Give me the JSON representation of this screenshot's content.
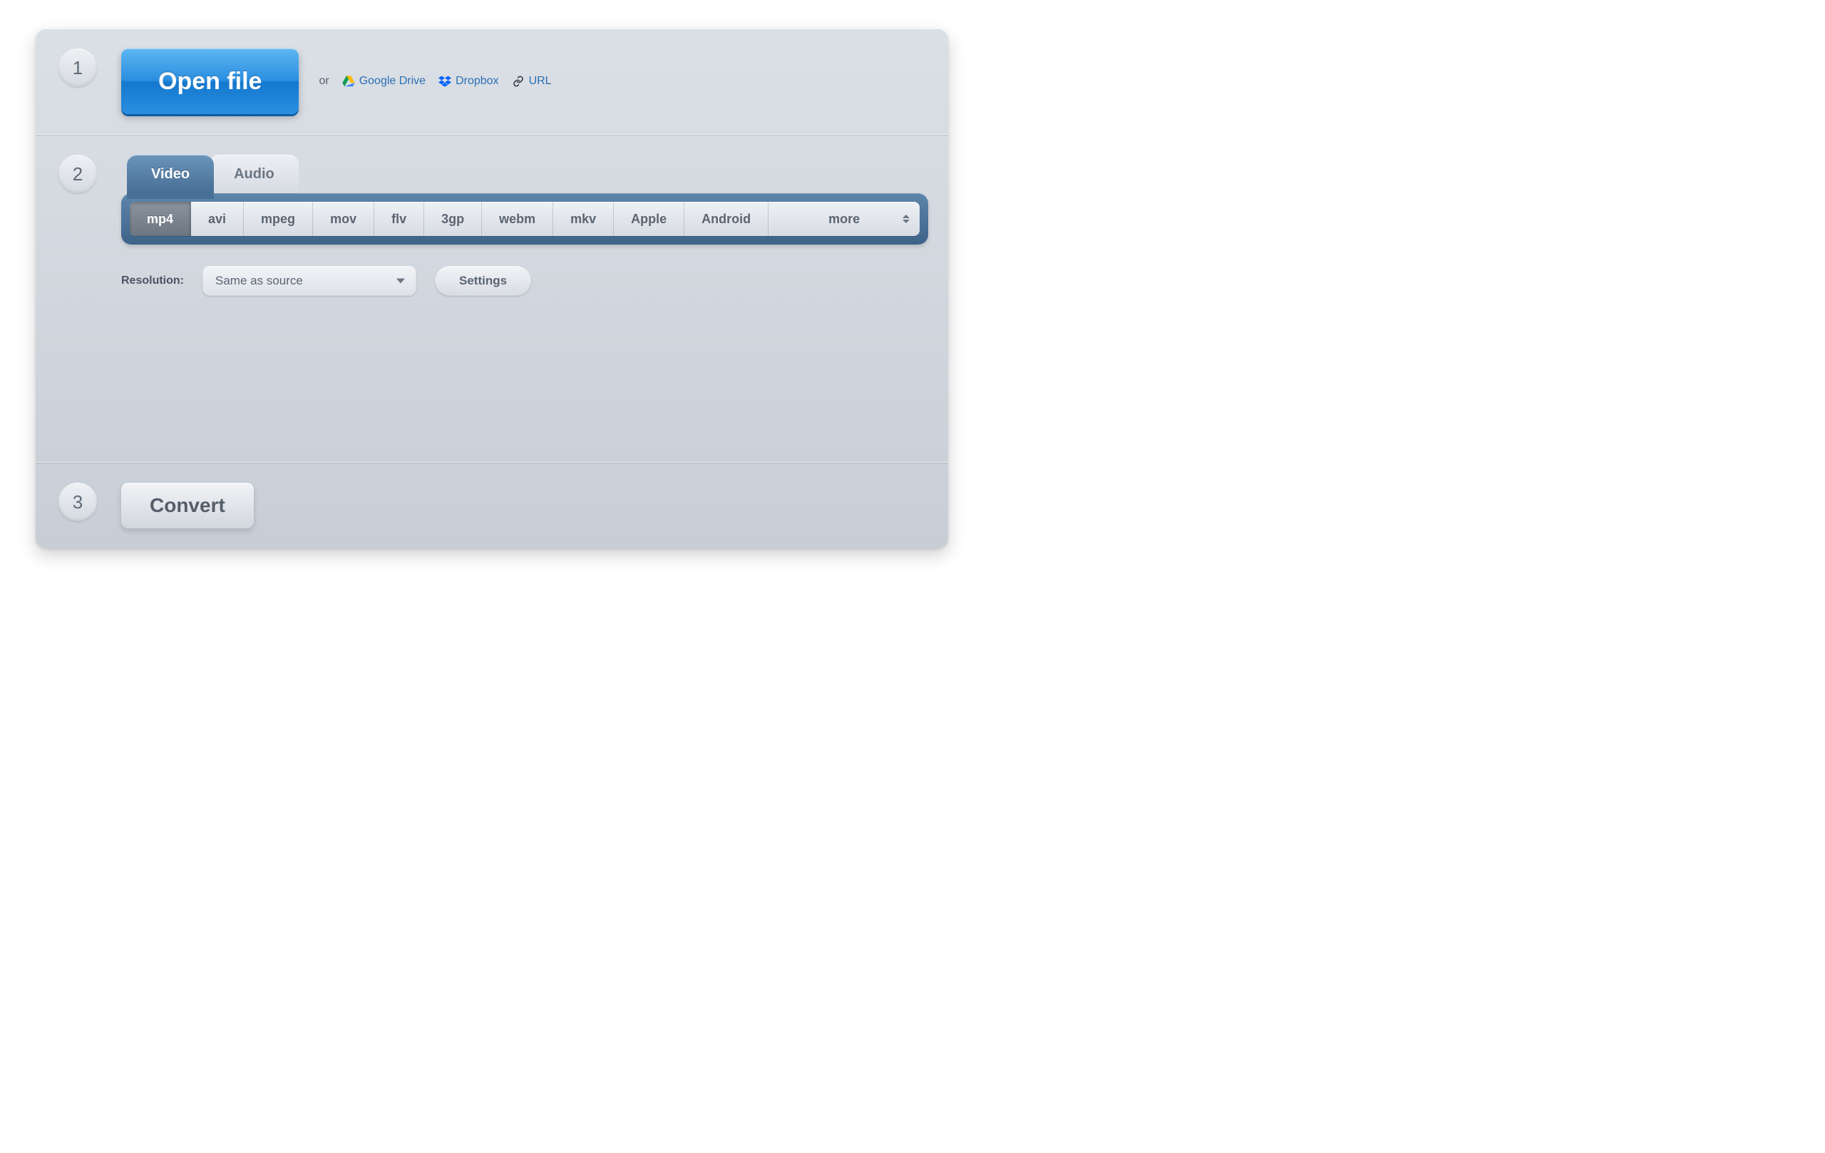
{
  "steps": {
    "one": "1",
    "two": "2",
    "three": "3"
  },
  "open": {
    "button": "Open file",
    "or": "or",
    "sources": {
      "gdrive": "Google Drive",
      "dropbox": "Dropbox",
      "url": "URL"
    }
  },
  "tabs": {
    "video": "Video",
    "audio": "Audio",
    "active": "video"
  },
  "formats": {
    "items": [
      "mp4",
      "avi",
      "mpeg",
      "mov",
      "flv",
      "3gp",
      "webm",
      "mkv",
      "Apple",
      "Android"
    ],
    "more": "more",
    "selected": "mp4"
  },
  "resolution": {
    "label": "Resolution:",
    "value": "Same as source"
  },
  "settings_button": "Settings",
  "convert_button": "Convert"
}
